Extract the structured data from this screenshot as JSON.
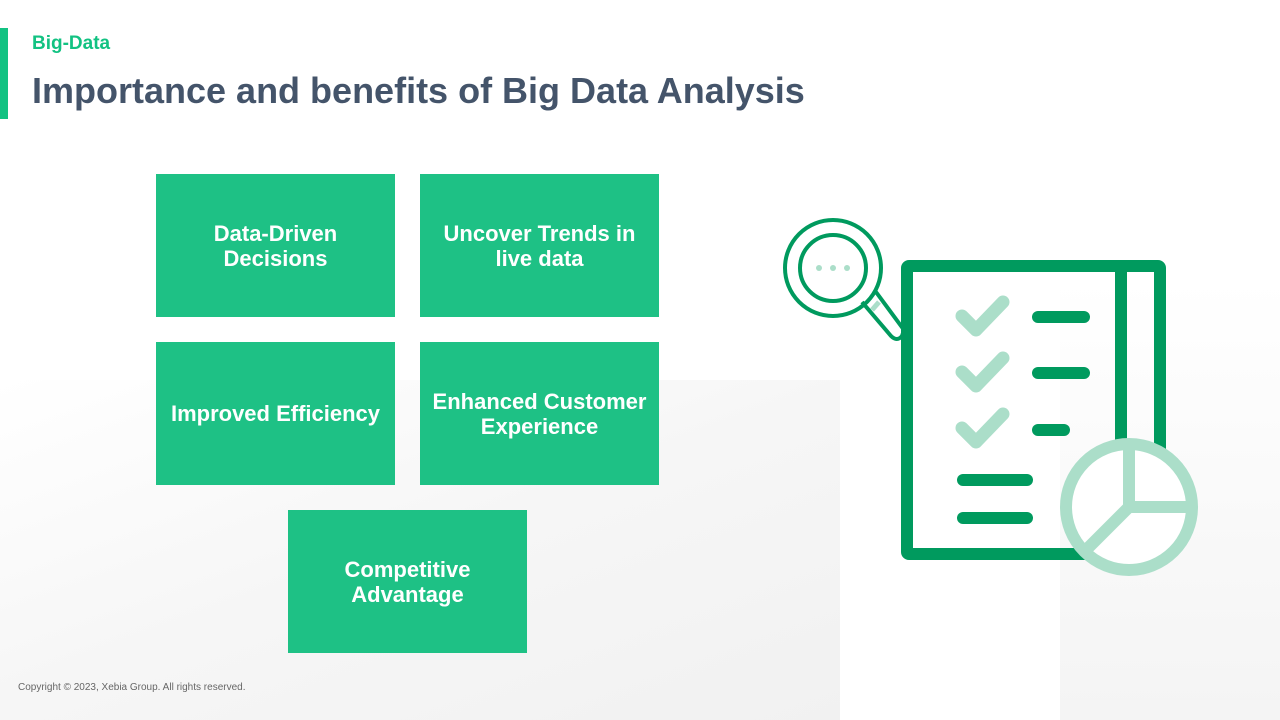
{
  "header": {
    "section": "Big-Data",
    "title": "Importance and benefits of Big Data Analysis"
  },
  "benefits": [
    {
      "label": "Data-Driven Decisions"
    },
    {
      "label": "Uncover Trends in live data"
    },
    {
      "label": "Improved Efficiency"
    },
    {
      "label": "Enhanced Customer Experience"
    },
    {
      "label": "Competitive Advantage"
    }
  ],
  "footer": {
    "copyright": "Copyright © 2023, Xebia Group. All rights reserved."
  },
  "colors": {
    "accent": "#12c282",
    "box": "#1ec185",
    "title": "#44546a",
    "icon_dark": "#009a5e",
    "icon_light": "#abdec9"
  }
}
